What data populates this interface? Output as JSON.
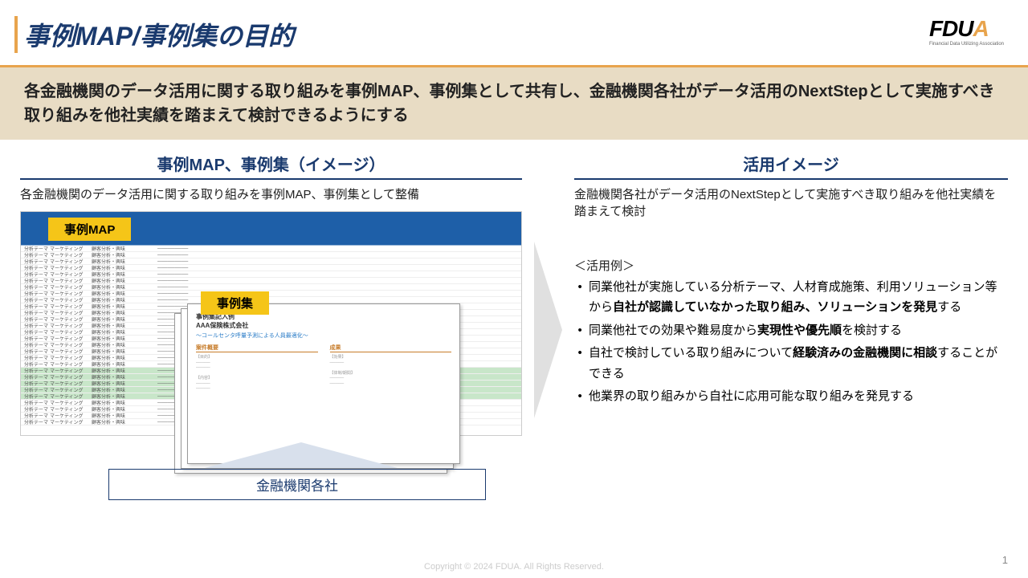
{
  "header": {
    "title": "事例MAP/事例集の目的",
    "logo_main": "FDU",
    "logo_accent": "A",
    "logo_sub": "Financial Data Utilizing Association"
  },
  "purpose": "各金融機関のデータ活用に関する取り組みを事例MAP、事例集として共有し、金融機関各社がデータ活用のNextStepとして実施すべき取り組みを他社実績を踏まえて検討できるようにする",
  "left": {
    "title": "事例MAP、事例集（イメージ）",
    "desc": "各金融機関のデータ活用に関する取り組みを事例MAP、事例集として整備",
    "map_label": "事例MAP",
    "collection_label": "事例集",
    "bottom_label": "金融機関各社",
    "doc": {
      "heading": "事例集記入例",
      "company": "AAA保険株式会社",
      "subtitle": "～コールセンタ呼量予測による人員最適化～",
      "col1_h": "案件概要",
      "col2_h": "成果"
    }
  },
  "right": {
    "title": "活用イメージ",
    "desc": "金融機関各社がデータ活用のNextStepとして実施すべき取り組みを他社実績を踏まえて検討",
    "usage_h": "＜活用例＞",
    "items": [
      {
        "pre": "同業他社が実施している分析テーマ、人材育成施策、利用ソリューション等から",
        "bold": "自社が認識していなかった取り組み、ソリューションを発見",
        "post": "する"
      },
      {
        "pre": "同業他社での効果や難易度から",
        "bold": "実現性や優先順",
        "post": "を検討する"
      },
      {
        "pre": "自社で検討している取り組みについて",
        "bold": "経験済みの金融機関に相談",
        "post": "することができる"
      },
      {
        "pre": "他業界の取り組みから自社に応用可能な取り組みを発見する",
        "bold": "",
        "post": ""
      }
    ]
  },
  "footer": {
    "page": "1",
    "copyright": "Copyright © 2024 FDUA. All Rights Reserved."
  }
}
